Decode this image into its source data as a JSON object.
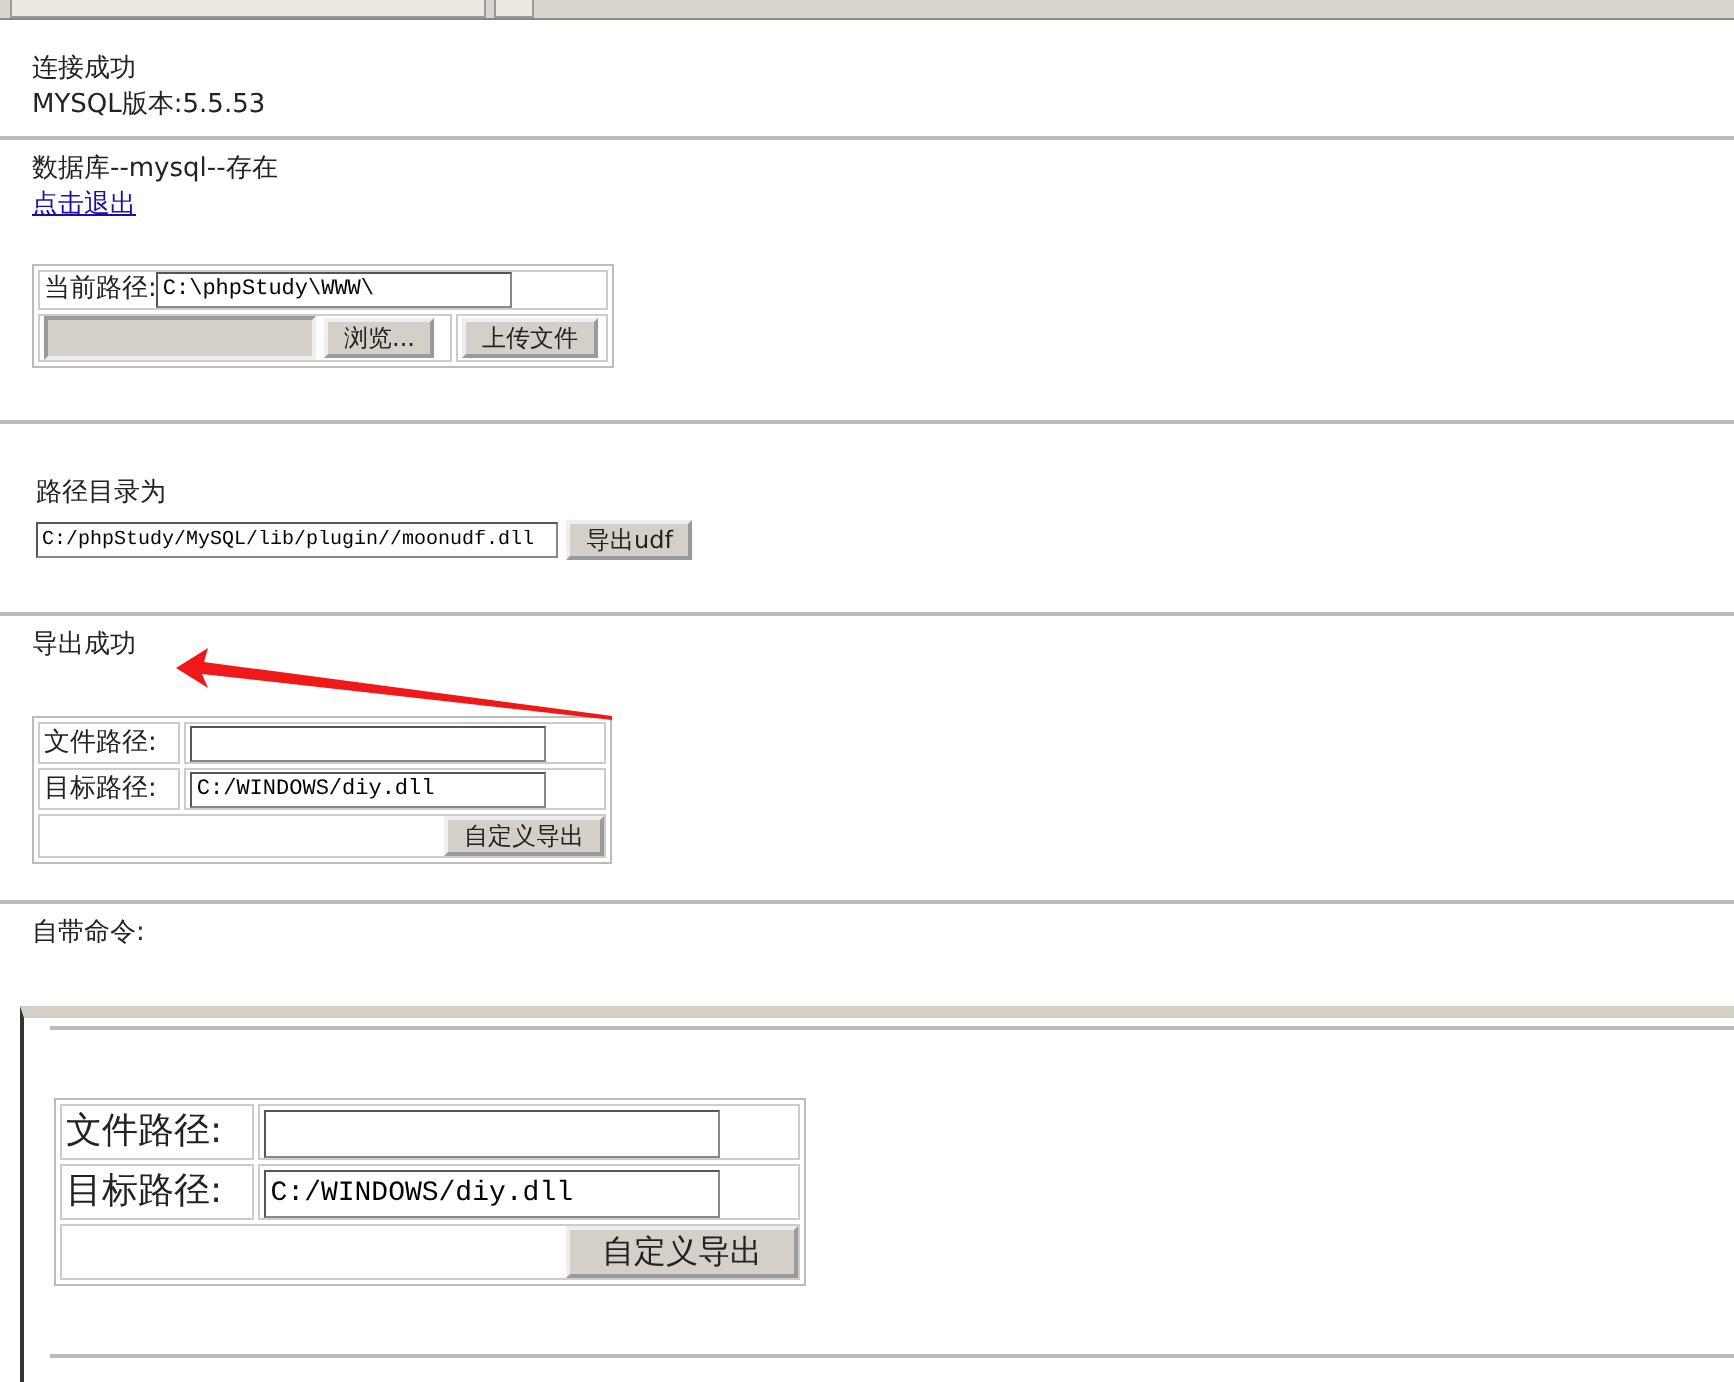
{
  "status": {
    "lines": [
      "连接成功",
      "MYSQL版本:5.5.53"
    ]
  },
  "database": {
    "text": "数据库--mysql--存在",
    "logout_link": "点击退出"
  },
  "upload_form": {
    "label": "当前路径:",
    "path": "C:\\phpStudy\\WWW\\",
    "browse_button": "浏览...",
    "upload_button": "上传文件"
  },
  "udf": {
    "heading": "路径目录为",
    "path": "C:/phpStudy/MySQL/lib/plugin//moonudf.dll",
    "button": "导出udf"
  },
  "export_message": "导出成功",
  "custom_export": {
    "rows": [
      {
        "label": "文件路径:"
      },
      {
        "label": "目标路径:",
        "value": "C:/WINDOWS/diy.dll"
      }
    ],
    "button": "自定义导出"
  },
  "builtin_commands_label": "自带命令:",
  "overlay_window": {
    "custom_export": {
      "rows": [
        {
          "label": "文件路径:"
        },
        {
          "label": "目标路径:",
          "value": "C:/WINDOWS/diy.dll"
        }
      ],
      "button": "自定义导出"
    }
  }
}
